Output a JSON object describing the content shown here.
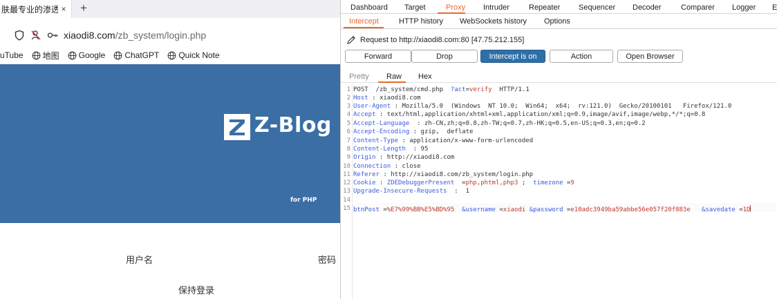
{
  "firefox": {
    "tab": {
      "title": "肤最专业的渗透",
      "close": "×"
    },
    "new_tab": "+",
    "url": {
      "host": "xiaodi8.com",
      "path": "/zb_system/login.php"
    },
    "bookmarks": [
      "uTube",
      "地图",
      "Google",
      "ChatGPT",
      "Quick Note"
    ],
    "page": {
      "logo_text": "Z-Blog",
      "logo_sub": "for PHP",
      "username_label": "用户名",
      "password_label": "密码",
      "remember_label": "保持登录"
    }
  },
  "burp": {
    "top_tabs": [
      "Dashboard",
      "Target",
      "Proxy",
      "Intruder",
      "Repeater",
      "Sequencer",
      "Decoder",
      "Comparer",
      "Logger",
      "E"
    ],
    "active_top_tab": "Proxy",
    "sub_tabs": [
      "Intercept",
      "HTTP history",
      "WebSockets history",
      "Options"
    ],
    "active_sub_tab": "Intercept",
    "request_line": "Request to http://xiaodi8.com:80  [47.75.212.155]",
    "buttons": {
      "forward": "Forward",
      "drop": "Drop",
      "intercept": "Intercept is on",
      "action": "Action",
      "open_browser": "Open Browser"
    },
    "view_tabs": [
      "Pretty",
      "Raw",
      "Hex"
    ],
    "active_view_tab": "Raw",
    "request": {
      "method": "POST",
      "path": "/zb_system/cmd.php",
      "query_name": "?act",
      "query_value": "verify",
      "version": "HTTP/1.1",
      "headers": [
        {
          "name": "Host",
          "value": "xiaodi8.com"
        },
        {
          "name": "User-Agent",
          "value": "Mozilla/5.0  (Windows  NT 10.0;  Win64;  x64;  rv:121.0)  Gecko/20100101   Firefox/121.0"
        },
        {
          "name": "Accept",
          "value": "text/html,application/xhtml+xml,application/xml;q=0.9,image/avif,image/webp,*/*;q=0.8"
        },
        {
          "name": "Accept-Language",
          "value": "zh-CN,zh;q=0.8,zh-TW;q=0.7,zh-HK;q=0.5,en-US;q=0.3,en;q=0.2"
        },
        {
          "name": "Accept-Encoding",
          "value": "gzip,  deflate"
        },
        {
          "name": "Content-Type",
          "value": "application/x-www-form-urlencoded"
        },
        {
          "name": "Content-Length",
          "value": "95"
        },
        {
          "name": "Origin",
          "value": "http://xiaodi8.com"
        },
        {
          "name": "Connection",
          "value": "close"
        },
        {
          "name": "Referer",
          "value": "http://xiaodi8.com/zb_system/login.php"
        },
        {
          "name": "Cookie",
          "value": ""
        },
        {
          "name": "Upgrade-Insecure-Requests",
          "value": "1"
        }
      ],
      "cookie_parts": {
        "n1": "ZDEDebuggerPresent",
        "v1": "php,phtml,php3",
        "n2": "timezone",
        "v2": "9"
      },
      "body": [
        {
          "name": "btnPost",
          "value": "%E7%99%BB%E5%BD%95"
        },
        {
          "name": "&username",
          "value": "xiaodi"
        },
        {
          "name": "&password",
          "value": "e10adc3949ba59abbe56e057f20f883e"
        },
        {
          "name": "&savedate",
          "value": "1D"
        }
      ]
    },
    "line_numbers": [
      "1",
      "2",
      "3",
      "4",
      "5",
      "6",
      "7",
      "8",
      "9",
      "10",
      "11",
      "12",
      "13",
      "14",
      "15"
    ]
  }
}
